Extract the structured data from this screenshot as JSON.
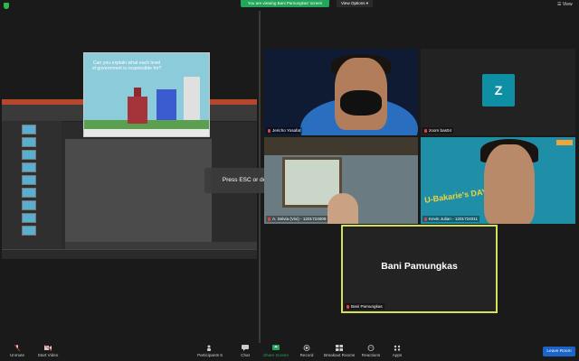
{
  "topbar": {
    "viewing_banner": "You are viewing Bani Pamungkas' screen",
    "view_options": "View Options ▾",
    "view_menu": "☰ View"
  },
  "share": {
    "slide_text": "Can you explain what each level of government is responsible for?",
    "notice": "Press ESC or double-click to exit full screen mode"
  },
  "tiles": [
    {
      "name": "Jericho Yosafat"
    },
    {
      "name": "zoom bas04",
      "initial": "Z"
    },
    {
      "name": "A. Selvia (Vivi) - 1201724009"
    },
    {
      "name": "Kevin Julian - 1201724011",
      "badge": "U-Bakarie's DAY"
    },
    {
      "name": "Bani Pamungkas",
      "big_name": "Bani Pamungkas"
    }
  ],
  "toolbar": {
    "unmute": "Unmute",
    "start_video": "Start Video",
    "participants": "Participants",
    "participants_count": "5",
    "chat": "Chat",
    "share_screen": "Share Screen",
    "record": "Record",
    "breakout": "Breakout Rooms",
    "reactions": "Reactions",
    "apps": "Apps",
    "leave": "Leave Room"
  },
  "colors": {
    "accent_green": "#23a55a",
    "active_speaker": "#d6e05a",
    "leave_blue": "#1d64c8",
    "avatar_teal": "#0f8fa4"
  }
}
